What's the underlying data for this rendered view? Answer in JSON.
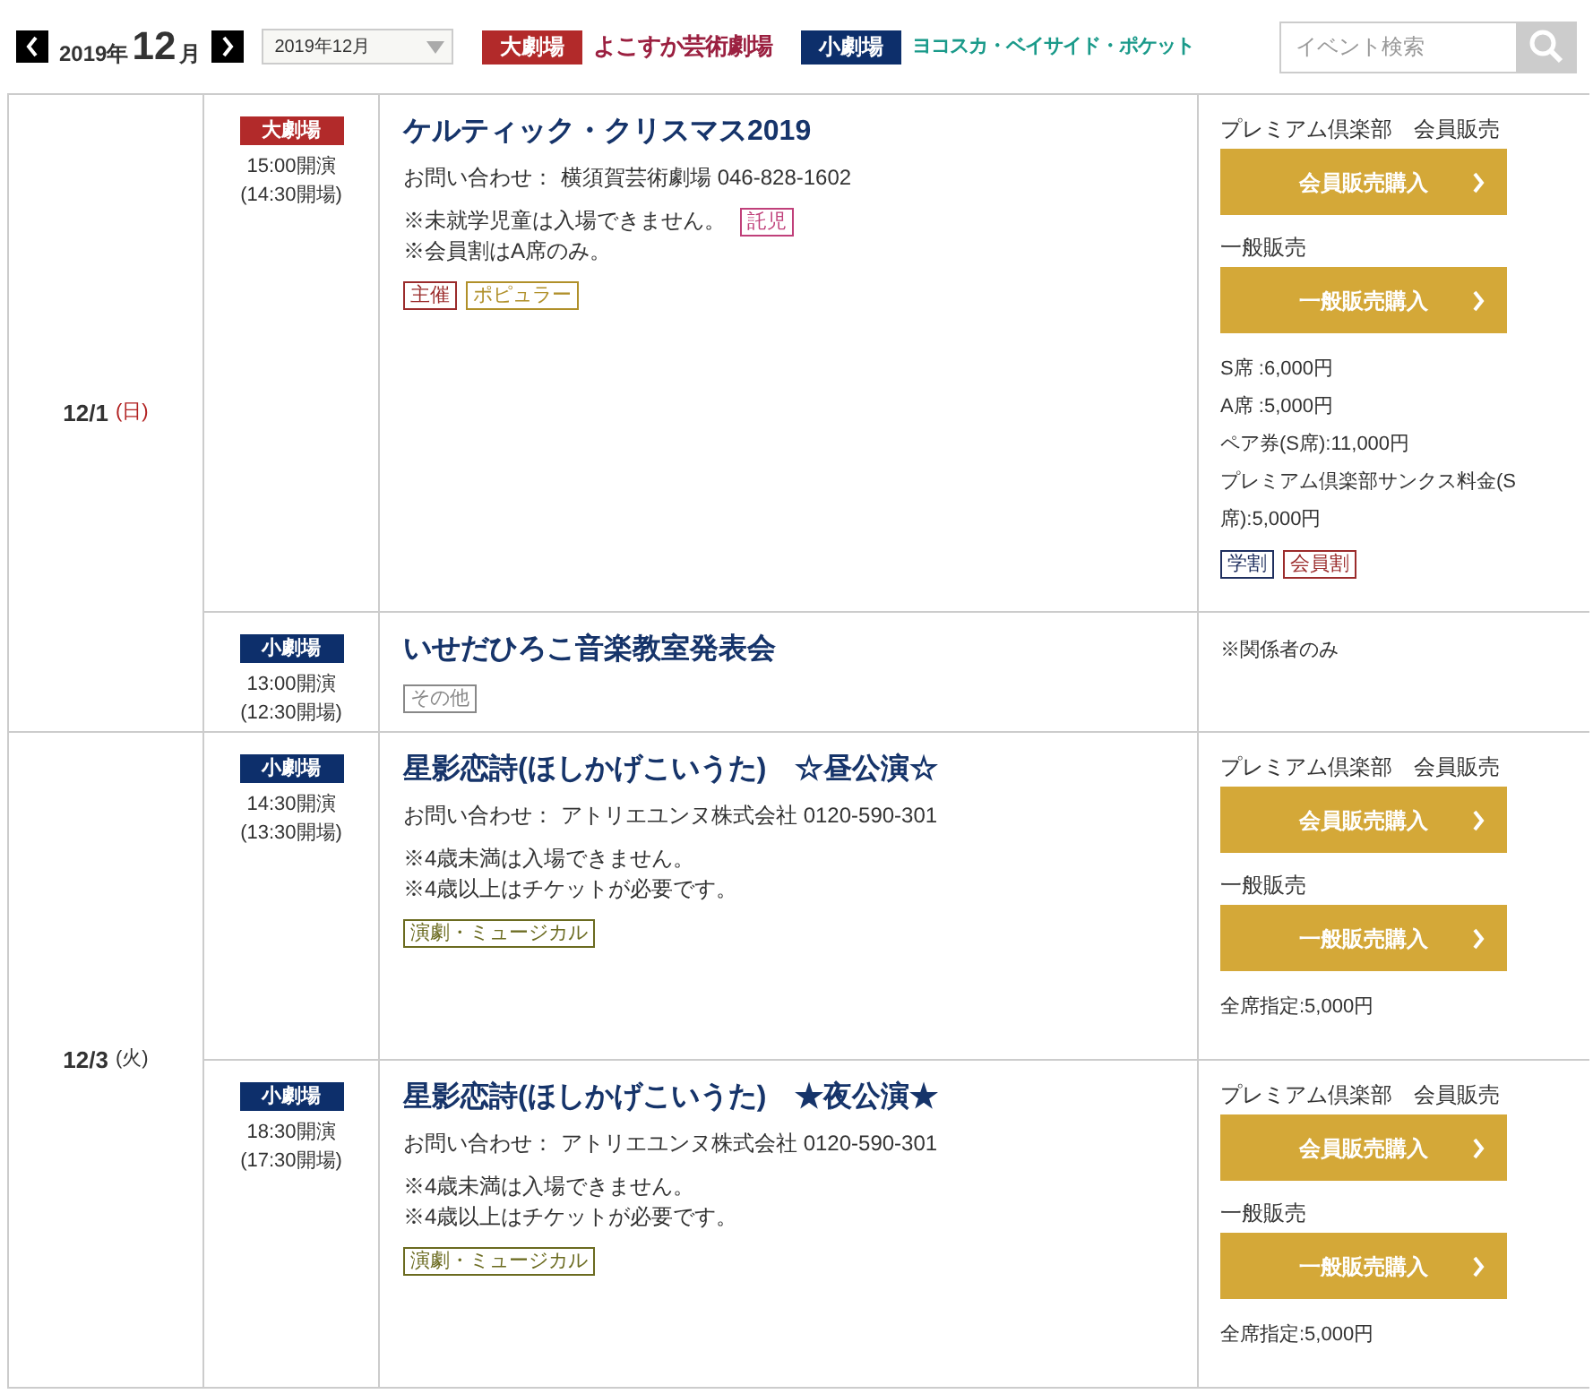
{
  "header": {
    "year": "2019年",
    "month": "12",
    "month_suffix": "月",
    "month_select": "2019年12月",
    "venues": [
      {
        "kind": "large",
        "badge": "大劇場",
        "name": "よこすか芸術劇場"
      },
      {
        "kind": "small",
        "badge": "小劇場",
        "name": "ヨコスカ・ベイサイド・ポケット"
      }
    ],
    "search": {
      "placeholder": "イベント検索"
    }
  },
  "days": [
    {
      "date": "12/1",
      "weekday": "(日)",
      "color": "#b22222",
      "events": [
        {
          "kind": "large",
          "venue": "大劇場",
          "start": "15:00開演",
          "doors": "(14:30開場)",
          "title": "ケルティック・クリスマス2019",
          "contact_label": "お問い合わせ：",
          "contact": "横須賀芸術劇場 046-828-1602",
          "notes": [
            {
              "text": "※未就学児童は入場できません。",
              "tags": [
                {
                  "label": "託児",
                  "color": "#c0407a"
                }
              ]
            },
            {
              "text": "※会員割はA席のみ。"
            }
          ],
          "tags": [
            {
              "label": "主催",
              "color": "#9b2c2c"
            },
            {
              "label": "ポピュラー",
              "color": "#b0902a"
            }
          ],
          "sales": [
            {
              "label": "プレミアム倶楽部　会員販売",
              "button": "会員販売購入"
            },
            {
              "label": "一般販売",
              "button": "一般販売購入"
            }
          ],
          "prices": [
            "S席 :6,000円",
            "A席 :5,000円",
            "ペア券(S席):11,000円",
            "プレミアム倶楽部サンクス料金(S席):5,000円"
          ],
          "discounts": [
            {
              "label": "学割",
              "color": "#1f2f5f"
            },
            {
              "label": "会員割",
              "color": "#9b2c2c"
            }
          ]
        },
        {
          "kind": "small",
          "venue": "小劇場",
          "start": "13:00開演",
          "doors": "(12:30開場)",
          "title": "いせだひろこ音楽教室発表会",
          "tags": [
            {
              "label": "その他",
              "color": "#888888"
            }
          ],
          "prices": [
            "※関係者のみ"
          ]
        }
      ]
    },
    {
      "date": "12/3",
      "weekday": "(火)",
      "color": "#333333",
      "events": [
        {
          "kind": "small",
          "venue": "小劇場",
          "start": "14:30開演",
          "doors": "(13:30開場)",
          "title": "星影恋詩(ほしかげこいうた)　☆昼公演☆",
          "contact_label": "お問い合わせ：",
          "contact": "アトリエユンヌ株式会社 0120-590-301",
          "notes": [
            {
              "text": "※4歳未満は入場できません。"
            },
            {
              "text": "※4歳以上はチケットが必要です。"
            }
          ],
          "tags": [
            {
              "label": "演劇・ミュージカル",
              "color": "#6b6b20"
            }
          ],
          "sales": [
            {
              "label": "プレミアム倶楽部　会員販売",
              "button": "会員販売購入"
            },
            {
              "label": "一般販売",
              "button": "一般販売購入"
            }
          ],
          "prices": [
            "全席指定:5,000円"
          ]
        },
        {
          "kind": "small",
          "venue": "小劇場",
          "start": "18:30開演",
          "doors": "(17:30開場)",
          "title": "星影恋詩(ほしかげこいうた)　★夜公演★",
          "contact_label": "お問い合わせ：",
          "contact": "アトリエユンヌ株式会社 0120-590-301",
          "notes": [
            {
              "text": "※4歳未満は入場できません。"
            },
            {
              "text": "※4歳以上はチケットが必要です。"
            }
          ],
          "tags": [
            {
              "label": "演劇・ミュージカル",
              "color": "#6b6b20"
            }
          ],
          "sales": [
            {
              "label": "プレミアム倶楽部　会員販売",
              "button": "会員販売購入"
            },
            {
              "label": "一般販売",
              "button": "一般販売購入"
            }
          ],
          "prices": [
            "全席指定:5,000円"
          ]
        }
      ]
    }
  ]
}
